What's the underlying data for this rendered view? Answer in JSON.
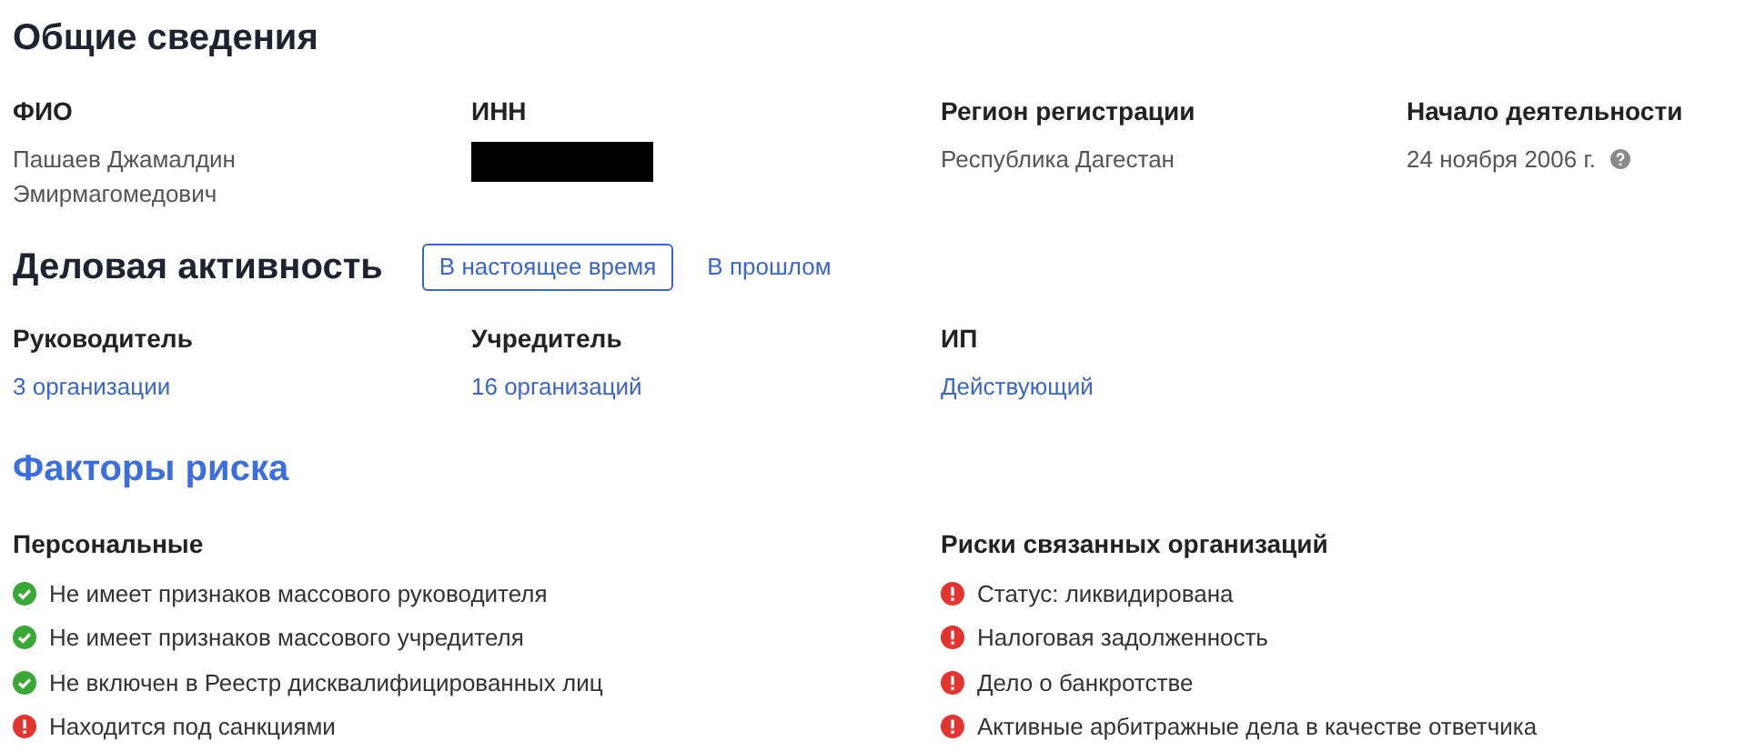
{
  "general": {
    "title": "Общие сведения",
    "fields": [
      {
        "label": "ФИО",
        "value": "Пашаев Джамалдин Эмирмагомедович",
        "kind": "text"
      },
      {
        "label": "ИНН",
        "kind": "redacted"
      },
      {
        "label": "Регион регистрации",
        "value": "Республика Дагестан",
        "kind": "text"
      },
      {
        "label": "Начало деятельности",
        "value": "24 ноября 2006 г.",
        "kind": "help"
      }
    ]
  },
  "activity": {
    "title": "Деловая активность",
    "tabs": [
      {
        "label": "В настоящее время",
        "selected": true
      },
      {
        "label": "В прошлом",
        "selected": false
      }
    ],
    "items": [
      {
        "label": "Руководитель",
        "value": "3 организации"
      },
      {
        "label": "Учредитель",
        "value": "16 организаций"
      },
      {
        "label": "ИП",
        "value": "Действующий"
      }
    ]
  },
  "risks": {
    "title": "Факторы риска",
    "groups": [
      {
        "title": "Персональные",
        "items": [
          {
            "text": "Не имеет признаков массового руководителя",
            "kind": "ok"
          },
          {
            "text": "Не имеет признаков массового учредителя",
            "kind": "ok"
          },
          {
            "text": "Не включен в Реестр дисквалифицированных лиц",
            "kind": "ok"
          },
          {
            "text": "Находится под санкциями",
            "kind": "warn"
          }
        ]
      },
      {
        "title": "Риски связанных организаций",
        "items": [
          {
            "text": "Статус: ликвидирована",
            "kind": "warn"
          },
          {
            "text": "Налоговая задолженность",
            "kind": "warn"
          },
          {
            "text": "Дело о банкротстве",
            "kind": "warn"
          },
          {
            "text": "Активные арбитражные дела в качестве ответчика",
            "kind": "warn"
          }
        ]
      }
    ]
  }
}
